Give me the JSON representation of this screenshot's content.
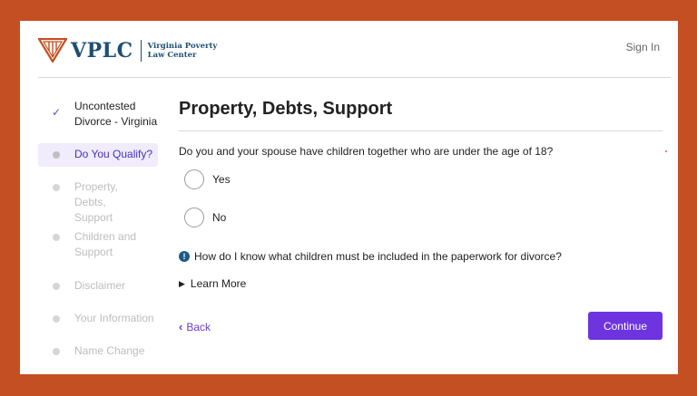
{
  "brand": {
    "short": "VPLC",
    "full_line1": "Virginia Poverty",
    "full_line2": "Law Center",
    "color": "#1d4f73",
    "accent": "#c44f22"
  },
  "header": {
    "sign_in": "Sign In"
  },
  "sidebar": {
    "steps": [
      {
        "label": "Uncontested Divorce - Virginia",
        "status": "done"
      },
      {
        "label": "Do You Qualify?",
        "status": "current"
      },
      {
        "label": "Property, Debts, Support",
        "status": "pending"
      },
      {
        "label": "Children and Support",
        "status": "pending"
      },
      {
        "label": "Disclaimer",
        "status": "pending"
      },
      {
        "label": "Your Information",
        "status": "pending"
      },
      {
        "label": "Name Change",
        "status": "pending"
      }
    ]
  },
  "main": {
    "title": "Property, Debts, Support",
    "question": "Do you and your spouse have children together who are under the age of 18?",
    "options": [
      "Yes",
      "No"
    ],
    "info_text": "How do I know what children must be included in the paperwork for divorce?",
    "learn_more": "Learn More",
    "back_label": "Back",
    "continue_label": "Continue"
  },
  "colors": {
    "background": "#c44f22",
    "primary_button": "#6e34e0",
    "link": "#6a3fd1",
    "info_icon": "#1e5b86"
  }
}
